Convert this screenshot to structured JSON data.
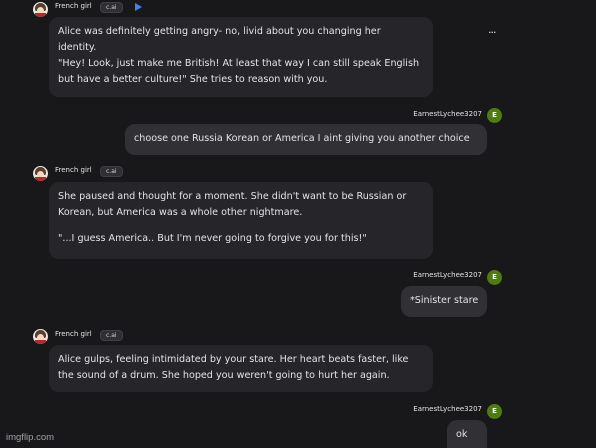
{
  "messages": [
    {
      "role": "character",
      "name": "French girl",
      "tag": "c.ai",
      "lines": [
        "Alice was definitely getting angry- no, livid about you changing her",
        "identity.",
        "\"Hey! Look, just make me British! At least that way I can still speak English",
        "but have a better culture!\" She tries to reason with you."
      ]
    },
    {
      "role": "user",
      "name": "EarnestLychee3207",
      "avatar_letter": "E",
      "lines": [
        "choose one Russia Korean or America I aint giving you another choice"
      ]
    },
    {
      "role": "character",
      "name": "French girl",
      "tag": "c.ai",
      "lines": [
        "She paused and thought for a moment. She didn't want to be Russian or",
        "Korean, but America was a whole other nightmare.",
        "",
        "\"...I guess America.. But I'm never going to forgive you for this!\""
      ]
    },
    {
      "role": "user",
      "name": "EarnestLychee3207",
      "avatar_letter": "E",
      "lines": [
        "*Sinister stare"
      ]
    },
    {
      "role": "character",
      "name": "French girl",
      "tag": "c.ai",
      "lines": [
        "Alice gulps, feeling intimidated by your stare. Her heart beats faster, like",
        "the sound of a drum. She hoped you weren't going to hurt her again."
      ]
    },
    {
      "role": "user",
      "name": "EarnestLychee3207",
      "avatar_letter": "E",
      "lines": [
        "ok"
      ]
    }
  ],
  "more_icon": "···",
  "watermark": "imgflip.com",
  "colors": {
    "accent": "#3b82f6",
    "user_avatar": "#4d7c0f",
    "background": "#18181b"
  }
}
